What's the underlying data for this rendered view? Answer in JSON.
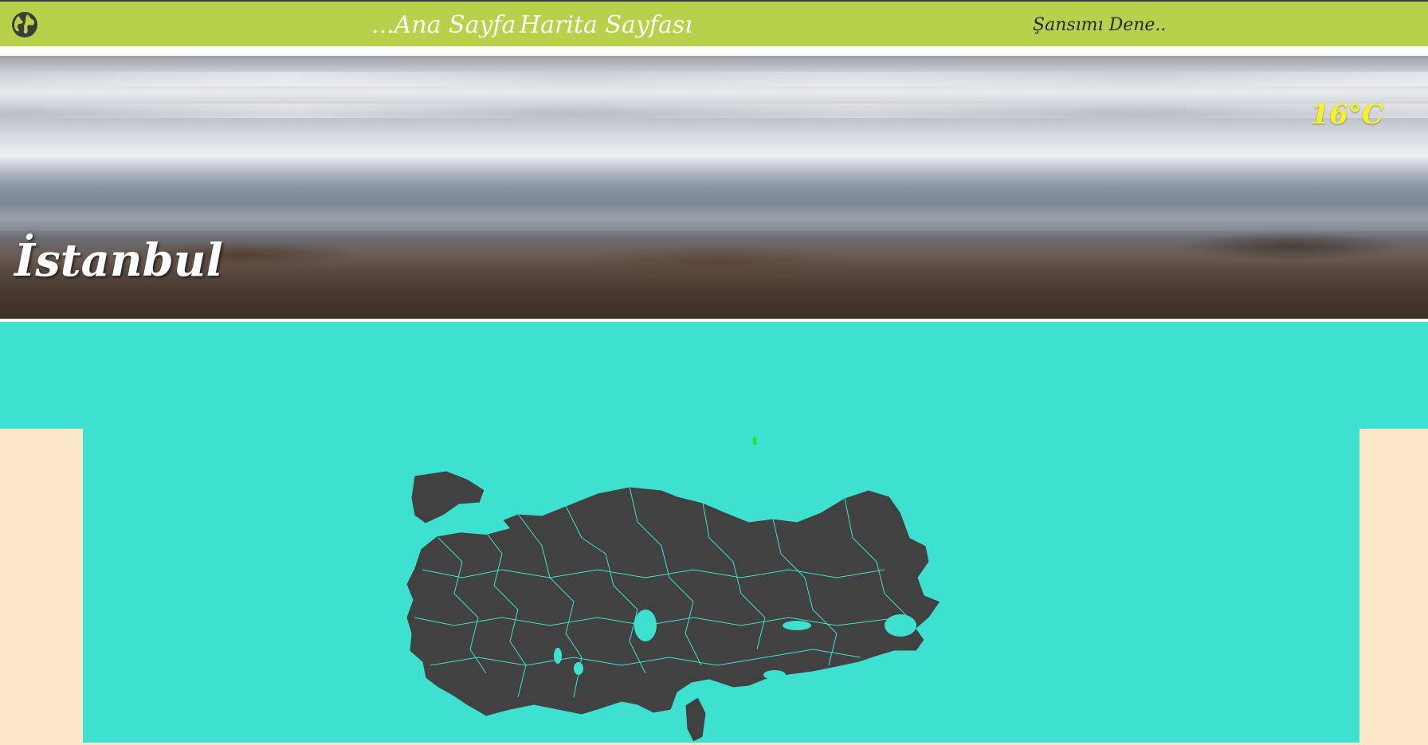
{
  "navbar": {
    "logo_icon": "globe-icon",
    "home_label": "...Ana Sayfa",
    "map_label": "Harita Sayfası",
    "luck_label": "Şansımı Dene..",
    "bg_color": "#b7d24a"
  },
  "banner": {
    "city": "İstanbul",
    "temperature": "16°C",
    "temperature_color": "#f6f21c"
  },
  "map": {
    "icon": "turkey-map",
    "fill_color": "#414141",
    "background_color": "#3ee0d0"
  },
  "page": {
    "side_color": "#fbe8c8"
  }
}
